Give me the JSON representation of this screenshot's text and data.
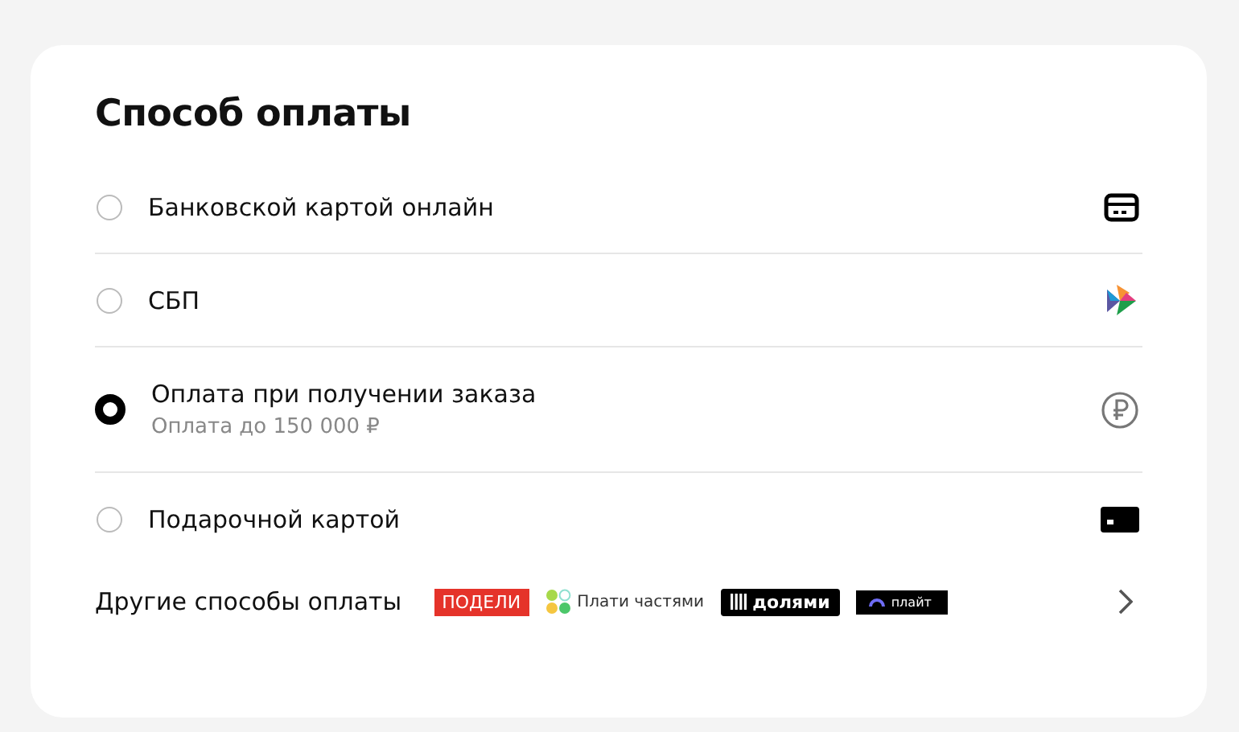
{
  "title": "Способ оплаты",
  "methods": [
    {
      "label": "Банковской картой онлайн",
      "selected": false,
      "kind": "card"
    },
    {
      "label": "СБП",
      "selected": false,
      "kind": "sbp"
    },
    {
      "label": "Оплата при получении заказа",
      "note": "Оплата до 150 000 ₽",
      "selected": true,
      "kind": "cash"
    },
    {
      "label": "Подарочной картой",
      "selected": false,
      "kind": "gift"
    }
  ],
  "other": {
    "label": "Другие способы оплаты",
    "services": [
      {
        "kind": "podeli",
        "label": "ПОДЕЛИ"
      },
      {
        "kind": "plati",
        "label": "Плати частями"
      },
      {
        "kind": "dolyami",
        "label": "долями"
      },
      {
        "kind": "plait",
        "label": "плайт"
      }
    ]
  }
}
